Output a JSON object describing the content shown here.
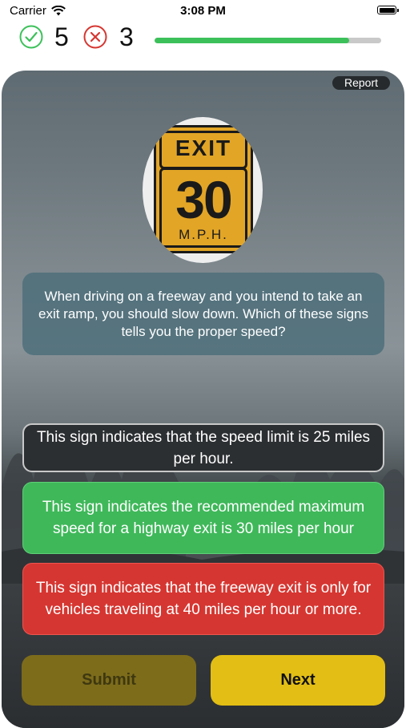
{
  "status_bar": {
    "carrier": "Carrier",
    "time": "3:08 PM",
    "wifi_icon": "wifi-icon",
    "battery_icon": "battery-icon"
  },
  "score": {
    "correct_count": "5",
    "wrong_count": "3",
    "correct_icon": "check-circle-icon",
    "wrong_icon": "x-circle-icon",
    "progress_fraction": 0.86
  },
  "card": {
    "report_label": "Report",
    "sign": {
      "top_text": "EXIT",
      "number": "30",
      "unit": "M.P.H."
    },
    "question": "When driving on a freeway and you intend to take an exit ramp, you should slow down. Which of these signs tells you the proper speed?",
    "answers": [
      {
        "text": "This sign indicates that the speed limit is 25 miles per hour.",
        "state": "neutral"
      },
      {
        "text": "This sign indicates the recommended maximum speed for a highway exit is 30 miles per hour",
        "state": "correct"
      },
      {
        "text": "This sign indicates that the freeway exit is only for vehicles traveling at 40 miles per hour or more.",
        "state": "wrong"
      }
    ],
    "submit_label": "Submit",
    "next_label": "Next"
  },
  "colors": {
    "correct_green": "#3fb85a",
    "wrong_red": "#d63631",
    "next_yellow": "#e3be14",
    "progress_green": "#3cc15a"
  }
}
